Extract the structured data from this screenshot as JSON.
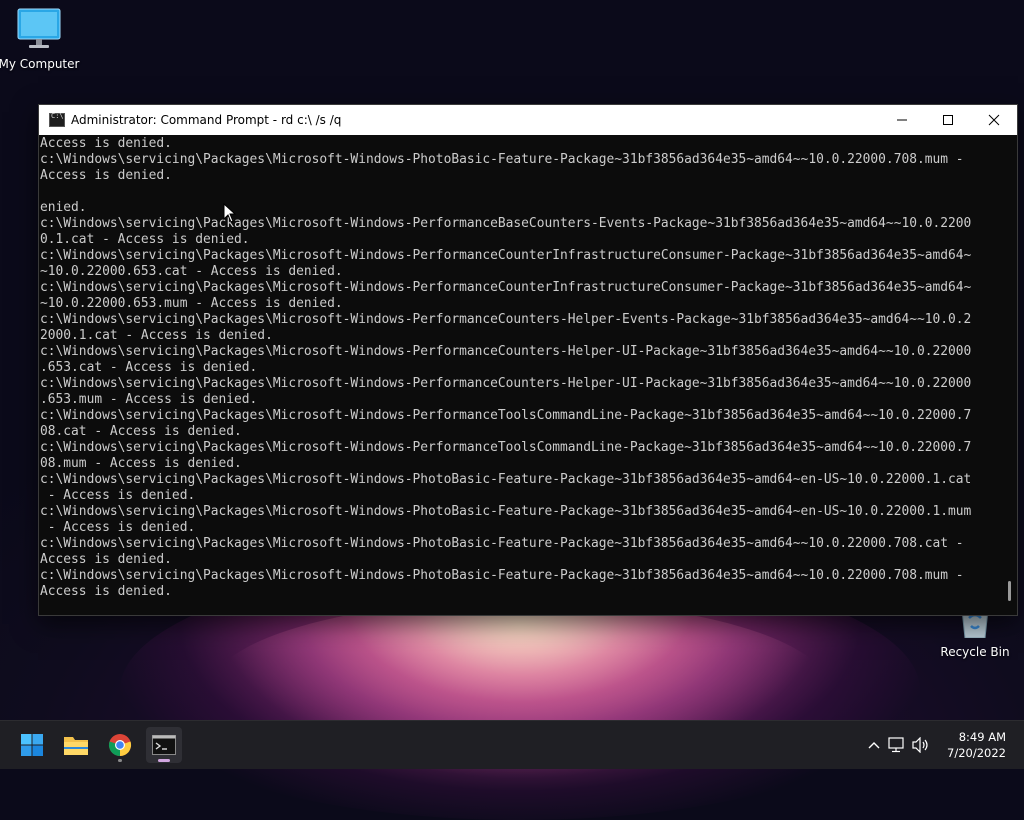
{
  "desktop": {
    "icons": [
      {
        "label": "My Computer"
      },
      {
        "label": "Recycle Bin"
      }
    ]
  },
  "window": {
    "title": "Administrator: Command Prompt - rd  c:\\ /s /q",
    "controls": {
      "minimize": "minimize-icon",
      "maximize": "maximize-icon",
      "close": "close-icon"
    },
    "console_lines": [
      "Access is denied.",
      "c:\\Windows\\servicing\\Packages\\Microsoft-Windows-PhotoBasic-Feature-Package~31bf3856ad364e35~amd64~~10.0.22000.708.mum -",
      "Access is denied.",
      "",
      "enied.",
      "c:\\Windows\\servicing\\Packages\\Microsoft-Windows-PerformanceBaseCounters-Events-Package~31bf3856ad364e35~amd64~~10.0.2200",
      "0.1.cat - Access is denied.",
      "c:\\Windows\\servicing\\Packages\\Microsoft-Windows-PerformanceCounterInfrastructureConsumer-Package~31bf3856ad364e35~amd64~",
      "~10.0.22000.653.cat - Access is denied.",
      "c:\\Windows\\servicing\\Packages\\Microsoft-Windows-PerformanceCounterInfrastructureConsumer-Package~31bf3856ad364e35~amd64~",
      "~10.0.22000.653.mum - Access is denied.",
      "c:\\Windows\\servicing\\Packages\\Microsoft-Windows-PerformanceCounters-Helper-Events-Package~31bf3856ad364e35~amd64~~10.0.2",
      "2000.1.cat - Access is denied.",
      "c:\\Windows\\servicing\\Packages\\Microsoft-Windows-PerformanceCounters-Helper-UI-Package~31bf3856ad364e35~amd64~~10.0.22000",
      ".653.cat - Access is denied.",
      "c:\\Windows\\servicing\\Packages\\Microsoft-Windows-PerformanceCounters-Helper-UI-Package~31bf3856ad364e35~amd64~~10.0.22000",
      ".653.mum - Access is denied.",
      "c:\\Windows\\servicing\\Packages\\Microsoft-Windows-PerformanceToolsCommandLine-Package~31bf3856ad364e35~amd64~~10.0.22000.7",
      "08.cat - Access is denied.",
      "c:\\Windows\\servicing\\Packages\\Microsoft-Windows-PerformanceToolsCommandLine-Package~31bf3856ad364e35~amd64~~10.0.22000.7",
      "08.mum - Access is denied.",
      "c:\\Windows\\servicing\\Packages\\Microsoft-Windows-PhotoBasic-Feature-Package~31bf3856ad364e35~amd64~en-US~10.0.22000.1.cat",
      " - Access is denied.",
      "c:\\Windows\\servicing\\Packages\\Microsoft-Windows-PhotoBasic-Feature-Package~31bf3856ad364e35~amd64~en-US~10.0.22000.1.mum",
      " - Access is denied.",
      "c:\\Windows\\servicing\\Packages\\Microsoft-Windows-PhotoBasic-Feature-Package~31bf3856ad364e35~amd64~~10.0.22000.708.cat -",
      "Access is denied.",
      "c:\\Windows\\servicing\\Packages\\Microsoft-Windows-PhotoBasic-Feature-Package~31bf3856ad364e35~amd64~~10.0.22000.708.mum -",
      "Access is denied."
    ]
  },
  "taskbar": {
    "items": [
      {
        "name": "start-button",
        "icon": "windows-logo-icon"
      },
      {
        "name": "file-explorer-button",
        "icon": "folder-icon"
      },
      {
        "name": "chrome-button",
        "icon": "chrome-icon"
      },
      {
        "name": "command-prompt-button",
        "icon": "terminal-icon",
        "active": true
      }
    ],
    "tray": {
      "icons": [
        "chevron-up-icon",
        "network-icon",
        "volume-icon"
      ],
      "time": "8:49 AM",
      "date": "7/20/2022"
    }
  },
  "colors": {
    "console_bg": "#0c0c0c",
    "console_fg": "#cccccc",
    "taskbar_bg": "#1f1f24",
    "active_indicator": "#d2a7e0"
  }
}
